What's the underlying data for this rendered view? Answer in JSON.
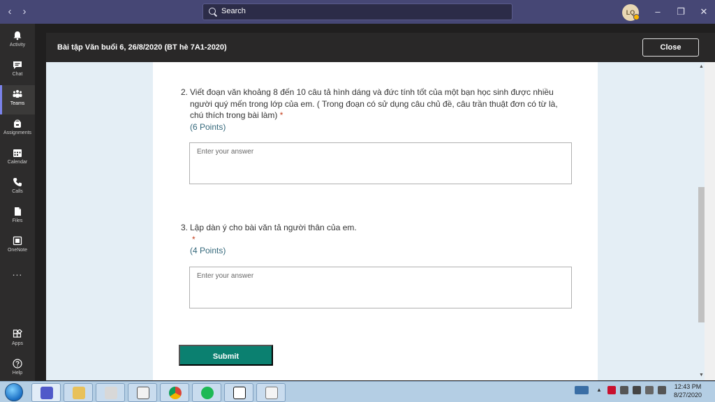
{
  "titlebar": {
    "search_placeholder": "Search",
    "avatar_initials": "LQ"
  },
  "rail": {
    "items": [
      {
        "label": "Activity"
      },
      {
        "label": "Chat"
      },
      {
        "label": "Teams"
      },
      {
        "label": "Assignments"
      },
      {
        "label": "Calendar"
      },
      {
        "label": "Calls"
      },
      {
        "label": "Files"
      },
      {
        "label": "OneNote"
      },
      {
        "label": "..."
      },
      {
        "label": "Apps"
      },
      {
        "label": "Help"
      }
    ]
  },
  "dialog": {
    "title": "Bài tập Văn buổi 6, 26/8/2020 (BT hè 7A1-2020)",
    "close_label": "Close"
  },
  "form": {
    "questions": [
      {
        "number": "2.",
        "text": "Viết đoạn văn khoảng 8 đến 10 câu tả hình dáng và đức tính tốt của một bạn học sinh được nhiều người quý mến trong lớp của em. ( Trong đoạn có sử dụng câu chủ đề, câu trần thuật đơn có từ là, chú thích trong bài làm)",
        "required_mark": "*",
        "points": "(6 Points)",
        "answer_placeholder": "Enter your answer"
      },
      {
        "number": "3.",
        "text": "Lập dàn ý cho bài văn tả người thân của em.",
        "required_mark": "*",
        "points": "(4 Points)",
        "answer_placeholder": "Enter your answer"
      }
    ],
    "submit_label": "Submit"
  },
  "taskbar": {
    "time": "12:43 PM",
    "date": "8/27/2020"
  },
  "colors": {
    "teams_purple": "#464775",
    "rail_bg": "#2d2c2c",
    "submit_green": "#0b8070",
    "points_teal": "#33677a",
    "required_red": "#c43e1c"
  }
}
